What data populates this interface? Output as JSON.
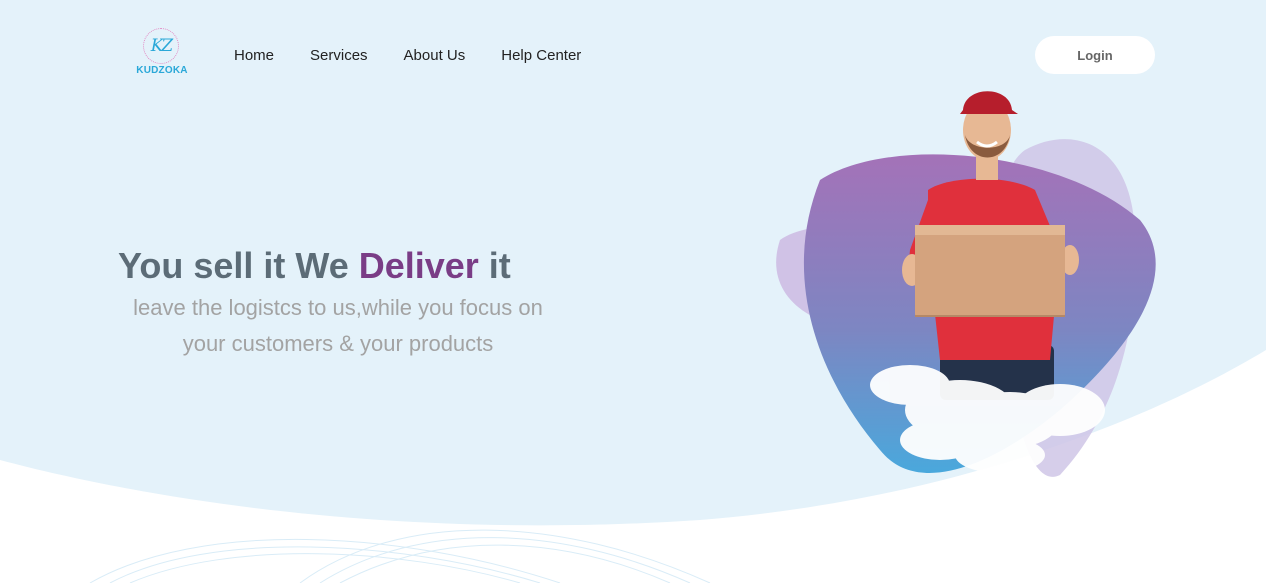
{
  "logo": {
    "mark": "KZ",
    "name": "KUDZOKA"
  },
  "nav": {
    "items": [
      {
        "label": "Home"
      },
      {
        "label": "Services"
      },
      {
        "label": "About Us"
      },
      {
        "label": "Help Center"
      }
    ]
  },
  "header": {
    "login_label": "Login"
  },
  "hero": {
    "headline_part1": "You sell it We ",
    "headline_accent": "Deliver",
    "headline_part2": " it",
    "subtitle_line1": "leave the logistcs to us,while you focus on",
    "subtitle_line2": "your customers & your products"
  },
  "colors": {
    "background": "#e4f2fa",
    "accent": "#7a3d86",
    "headline": "#5c6c77",
    "subtitle": "#a3a3a3",
    "logo": "#2aa8d8",
    "shirt": "#e0303c"
  },
  "icons": {
    "hero_image": "delivery-man-with-box-illustration"
  }
}
